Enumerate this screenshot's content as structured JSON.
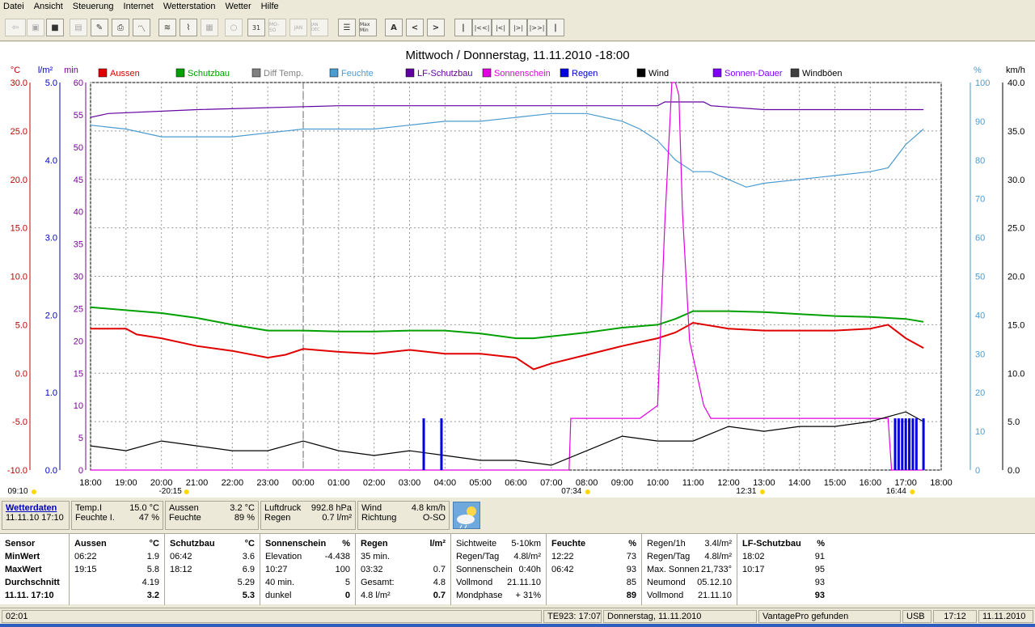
{
  "menu": [
    "Datei",
    "Ansicht",
    "Steuerung",
    "Internet",
    "Wetterstation",
    "Wetter",
    "Hilfe"
  ],
  "toolbar": {
    "icons": [
      "back-icon",
      "save-icon",
      "save-disk-icon",
      "report-icon",
      "edit-icon",
      "print-icon",
      "chart-icon",
      "graph-icon",
      "graph2-icon",
      "table-icon",
      "day-icon",
      "circle-icon",
      "calendar-31-icon",
      "week-icon",
      "month-icon",
      "year-icon",
      "list-icon",
      "minmax-icon"
    ],
    "label_31": "31",
    "label_mo_so": "MO-SO",
    "label_jan": "JAN",
    "label_jandez": "JAN DEC",
    "label_minmax": "Max Min",
    "btn_a": "A",
    "btn_prev": "<",
    "btn_next": ">",
    "btn_first": "|",
    "btn_rew2": "|<<|",
    "btn_rew1": "|<|",
    "btn_fwd1": "|>|",
    "btn_fwd2": "|>>|",
    "btn_last": "|"
  },
  "chart_data": {
    "type": "line",
    "title": "Mittwoch / Donnerstag, 11.11.2010  -18:00",
    "left_axes": [
      {
        "unit": "°C",
        "color": "#c00000",
        "ticks": [
          "30.0",
          "25.0",
          "20.0",
          "15.0",
          "10.0",
          "5.0",
          "0.0",
          "-5.0",
          "-10.0"
        ]
      },
      {
        "unit": "l/m²",
        "color": "#0000c0",
        "ticks": [
          "5.0",
          "4.0",
          "3.0",
          "2.0",
          "1.0",
          "0.0"
        ]
      },
      {
        "unit": "min",
        "color": "#8000a0",
        "ticks": [
          "60",
          "55",
          "50",
          "45",
          "40",
          "35",
          "30",
          "25",
          "20",
          "15",
          "10",
          "5",
          "0"
        ]
      }
    ],
    "right_axes": [
      {
        "unit": "%",
        "color": "#4a9bd0",
        "ticks": [
          "100",
          "90",
          "80",
          "70",
          "60",
          "50",
          "40",
          "30",
          "20",
          "10",
          "0"
        ]
      },
      {
        "unit": "km/h",
        "color": "#000000",
        "ticks": [
          "40.0",
          "35.0",
          "30.0",
          "25.0",
          "20.0",
          "15.0",
          "10.0",
          "5.0",
          "0.0"
        ]
      }
    ],
    "x_ticks": [
      "18:00",
      "19:00",
      "20:00",
      "21:00",
      "22:00",
      "23:00",
      "00:00",
      "01:00",
      "02:00",
      "03:00",
      "04:00",
      "05:00",
      "06:00",
      "07:00",
      "08:00",
      "09:00",
      "10:00",
      "11:00",
      "12:00",
      "13:00",
      "14:00",
      "15:00",
      "16:00",
      "17:00",
      "18:00"
    ],
    "markers": [
      {
        "label": "09:10",
        "x_hour": 0.0
      },
      {
        "label": "-20:15",
        "x_hour": 2.25
      },
      {
        "label": "07:34",
        "x_hour": 13.57
      },
      {
        "label": "12:31",
        "x_hour": 18.5
      },
      {
        "label": "16:44",
        "x_hour": 22.73
      }
    ],
    "legend": [
      {
        "name": "Aussen",
        "color": "#e00000"
      },
      {
        "name": "Schutzbau",
        "color": "#00a000"
      },
      {
        "name": "Diff Temp.",
        "color": "#808080"
      },
      {
        "name": "Feuchte",
        "color": "#4a9bd0"
      },
      {
        "name": "LF-Schutzbau",
        "color": "#6000a0"
      },
      {
        "name": "Sonnenschein",
        "color": "#e000e0"
      },
      {
        "name": "Regen",
        "color": "#0000e0"
      },
      {
        "name": "Wind",
        "color": "#000000"
      },
      {
        "name": "Sonnen-Dauer",
        "color": "#8000ff"
      },
      {
        "name": "Windböen",
        "color": "#404040"
      }
    ],
    "series": [
      {
        "name": "Aussen",
        "color": "#e00000",
        "axis": "temp",
        "x": [
          0,
          1,
          1.3,
          2,
          3,
          4,
          5,
          5.5,
          6,
          7,
          8,
          9,
          10,
          11,
          12,
          12.5,
          13,
          14,
          15,
          16,
          16.5,
          17,
          18,
          19,
          20,
          21,
          22,
          22.5,
          23,
          23.5
        ],
        "y": [
          4.6,
          4.6,
          4.0,
          3.6,
          2.8,
          2.3,
          1.6,
          1.9,
          2.5,
          2.2,
          2.0,
          2.4,
          2.0,
          2.0,
          1.6,
          0.4,
          1.0,
          1.9,
          2.8,
          3.6,
          4.2,
          5.2,
          4.6,
          4.4,
          4.4,
          4.4,
          4.6,
          5.0,
          3.6,
          2.6
        ]
      },
      {
        "name": "Schutzbau",
        "color": "#00a000",
        "axis": "temp",
        "x": [
          0,
          1,
          2,
          3,
          4,
          5,
          6,
          7,
          8,
          9,
          10,
          11,
          12,
          12.5,
          13,
          14,
          15,
          16,
          16.5,
          17,
          18,
          19,
          20,
          21,
          22,
          23,
          23.5
        ],
        "y": [
          6.8,
          6.5,
          6.2,
          5.7,
          5.0,
          4.4,
          4.4,
          4.3,
          4.3,
          4.4,
          4.4,
          4.1,
          3.6,
          3.6,
          3.8,
          4.2,
          4.7,
          5.0,
          5.6,
          6.4,
          6.4,
          6.3,
          6.1,
          5.9,
          5.8,
          5.6,
          5.3
        ]
      },
      {
        "name": "Feuchte",
        "color": "#4a9bd0",
        "axis": "hum",
        "x": [
          0,
          1,
          2,
          3,
          4,
          5,
          6,
          7,
          8,
          9,
          10,
          11,
          12,
          13,
          14,
          15,
          15.5,
          16,
          16.5,
          17,
          17.5,
          18,
          18.5,
          19,
          20,
          21,
          22,
          22.5,
          23,
          23.5
        ],
        "y": [
          89,
          88,
          86,
          86,
          86,
          87,
          88,
          88,
          88,
          89,
          90,
          90,
          91,
          92,
          92,
          90,
          88,
          85,
          80,
          77,
          77,
          75,
          73,
          74,
          75,
          76,
          77,
          78,
          84,
          88
        ]
      },
      {
        "name": "LF-Schutzbau",
        "color": "#6000a0",
        "axis": "hum",
        "x": [
          0,
          0.5,
          3,
          7,
          16,
          16.2,
          17.3,
          17.5,
          19,
          23.5
        ],
        "y": [
          91,
          92,
          93,
          94,
          94,
          95,
          95,
          94,
          93,
          93
        ]
      },
      {
        "name": "Sonnenschein",
        "color": "#e000e0",
        "axis": "min",
        "x": [
          0,
          13.5,
          13.55,
          15.5,
          16.0,
          16.2,
          16.4,
          16.5,
          16.6,
          16.7,
          16.9,
          17.3,
          17.5,
          18,
          18.5,
          22.5,
          22.6,
          23.5
        ],
        "y": [
          0,
          0,
          8,
          8,
          10,
          38,
          60,
          60,
          58,
          40,
          20,
          10,
          8,
          8,
          8,
          8,
          0,
          0
        ]
      },
      {
        "name": "Wind",
        "color": "#000000",
        "axis": "wind",
        "x": [
          0,
          1,
          2,
          3,
          4,
          5,
          6,
          7,
          8,
          9,
          10,
          11,
          12,
          13,
          14,
          15,
          16,
          17,
          18,
          19,
          20,
          21,
          22,
          23,
          23.5
        ],
        "y": [
          2.5,
          2.0,
          3.0,
          2.5,
          2.0,
          2.0,
          3.0,
          2.0,
          1.5,
          2.0,
          1.5,
          1.0,
          1.0,
          0.5,
          2.0,
          3.5,
          3.0,
          3.0,
          4.5,
          4.0,
          4.5,
          4.5,
          5.0,
          6.0,
          5.0
        ]
      }
    ],
    "rain_bars_x_hour": [
      9.4,
      9.9,
      22.7,
      22.8,
      22.9,
      23.0,
      23.1,
      23.2,
      23.3,
      23.5
    ]
  },
  "panel": {
    "wetterdaten": "Wetterdaten",
    "wetterdaten_time": "11.11.10 17:10",
    "tempi_label": "Temp.I",
    "tempi_value": "15.0 °C",
    "feuchtei_label": "Feuchte I.",
    "feuchtei_value": "47 %",
    "aussen_label": "Aussen",
    "aussen_value": "3.2 °C",
    "feuchte_label": "Feuchte",
    "feuchte_value": "89 %",
    "luftdruck_label": "Luftdruck",
    "luftdruck_value": "992.8 hPa",
    "regen_label": "Regen",
    "regen_value": "0.7 l/m²",
    "wind_label": "Wind",
    "wind_value": "4.8 km/h",
    "richtung_label": "Richtung",
    "richtung_value": "O-SO"
  },
  "stats": {
    "sensor": [
      "Sensor",
      "MinWert",
      "MaxWert",
      "Durchschnitt",
      "11.11. 17:10"
    ],
    "aussen": {
      "head": "Aussen",
      "unit": "°C",
      "rows": [
        [
          "06:22",
          "1.9"
        ],
        [
          "19:15",
          "5.8"
        ],
        [
          "",
          "4.19"
        ],
        [
          "",
          "3.2"
        ]
      ]
    },
    "schutzbau": {
      "head": "Schutzbau",
      "unit": "°C",
      "rows": [
        [
          "06:42",
          "3.6"
        ],
        [
          "18:12",
          "6.9"
        ],
        [
          "",
          "5.29"
        ],
        [
          "",
          "5.3"
        ]
      ]
    },
    "sonnenschein": {
      "head": "Sonnenschein",
      "unit": "%",
      "rows": [
        [
          "Elevation",
          "-4.438"
        ],
        [
          "10:27",
          "100"
        ],
        [
          "40 min.",
          "5"
        ],
        [
          "dunkel",
          "0"
        ]
      ]
    },
    "regen": {
      "head": "Regen",
      "unit": "l/m²",
      "rows": [
        [
          "35 min.",
          ""
        ],
        [
          "03:32",
          "0.7"
        ],
        [
          "Gesamt:",
          "4.8"
        ],
        [
          "4.8 l/m²",
          "0.7"
        ]
      ]
    },
    "sicht": {
      "rows": [
        [
          "Sichtweite",
          "5-10km"
        ],
        [
          "Regen/Tag",
          "4.8l/m²"
        ],
        [
          "Sonnenschein",
          "0:40h"
        ],
        [
          "Vollmond",
          "21.11.10"
        ],
        [
          "Mondphase",
          "+ 31%"
        ]
      ]
    },
    "feuchte": {
      "head": "Feuchte",
      "unit": "%",
      "rows": [
        [
          "12:22",
          "73"
        ],
        [
          "06:42",
          "93"
        ],
        [
          "",
          "85"
        ],
        [
          "",
          "89"
        ]
      ]
    },
    "regen1h": {
      "rows": [
        [
          "Regen/1h",
          "3.4l/m²"
        ],
        [
          "Regen/Tag",
          "4.8l/m²"
        ],
        [
          "Max. Sonnen",
          "21,733°"
        ],
        [
          "Neumond",
          "05.12.10"
        ],
        [
          "Vollmond",
          "21.11.10"
        ]
      ]
    },
    "lfschutzbau": {
      "head": "LF-Schutzbau",
      "unit": "%",
      "rows": [
        [
          "18:02",
          "91"
        ],
        [
          "10:17",
          "95"
        ],
        [
          "",
          "93"
        ],
        [
          "",
          "93"
        ]
      ]
    }
  },
  "status": {
    "left": "02:01",
    "te923": "TE923: 17:07",
    "date": "Donnerstag, 11.11.2010",
    "vantage": "VantagePro gefunden",
    "usb": "USB",
    "time": "17:12",
    "day": "11.11.2010"
  }
}
